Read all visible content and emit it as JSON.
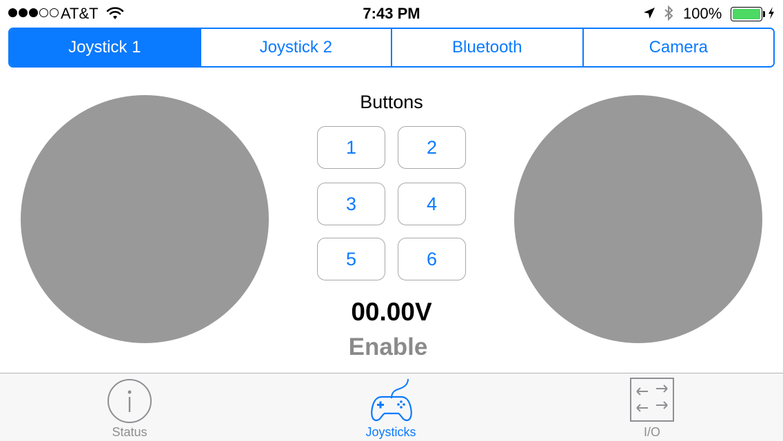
{
  "status_bar": {
    "carrier": "AT&T",
    "time": "7:43 PM",
    "battery_percent": "100%",
    "signal_strength": 3,
    "signal_max": 5
  },
  "segmented_control": {
    "segments": [
      "Joystick 1",
      "Joystick 2",
      "Bluetooth",
      "Camera"
    ],
    "selected_index": 0
  },
  "buttons_panel": {
    "title": "Buttons",
    "buttons": [
      "1",
      "2",
      "3",
      "4",
      "5",
      "6"
    ]
  },
  "voltage": "00.00V",
  "enable_label": "Enable",
  "tab_bar": {
    "tabs": [
      {
        "label": "Status",
        "icon": "info-icon"
      },
      {
        "label": "Joysticks",
        "icon": "gamepad-icon"
      },
      {
        "label": "I/O",
        "icon": "arrows-io-icon"
      }
    ],
    "active_index": 1
  },
  "colors": {
    "accent": "#0a7aff",
    "joystick": "#999999",
    "battery": "#4cd964",
    "inactive_tab": "#8e8e93"
  }
}
